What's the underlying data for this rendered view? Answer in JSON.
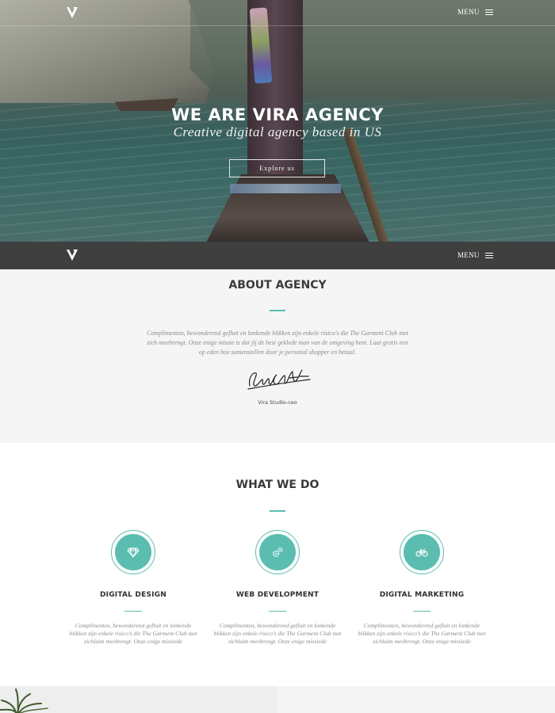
{
  "brand": {
    "logo_icon": "v-logo-icon"
  },
  "hero": {
    "menu_label": "MENU",
    "title": "WE ARE VIRA AGENCY",
    "subtitle": "Creative digital agency based in US",
    "cta_label": "Explore us"
  },
  "navbar": {
    "menu_label": "MENU"
  },
  "about": {
    "title": "ABOUT AGENCY",
    "lines": [
      "Complimenten, bewonderend gefluit en lonkende blikken zijn enkele risico's die The Garment Club met",
      "zich meebrengt. Onze enige missie is dat jij de best geklede man van de omgeving bent. Laat gratis een",
      "op eden box samenstellen door je personal shopper en betaal."
    ],
    "signature_icon": "signature-image",
    "signer": "Vira Studio-ceo"
  },
  "services": {
    "title": "WHAT WE DO",
    "items": [
      {
        "icon": "diamond-icon",
        "title": "DIGITAL DESIGN",
        "lines": [
          "Complimenten, bewonderend gefluit en lonkende",
          "blikken zijn enkele risico's die The Garment Club met",
          "zichlaim meebrengt. Onze enige missiede"
        ]
      },
      {
        "icon": "gears-icon",
        "title": "WEB DEVELOPMENT",
        "lines": [
          "Complimenten, bewonderend gefluit en lonkende",
          "blikken zijn enkele risico's die The Garment Club met",
          "zichlaim meebrengt. Onze enige missiede"
        ]
      },
      {
        "icon": "bicycle-icon",
        "title": "DIGITAL MARKETING",
        "lines": [
          "Complimenten, bewonderend gefluit en lonkende",
          "blikken zijn enkele risico's die The Garment Club met",
          "zichlaim meebrengt. Onze enige missiede"
        ]
      }
    ]
  },
  "colors": {
    "accent": "#5bbdb0",
    "navbar_bg": "#3f3f3f",
    "about_bg": "#f5f5f5"
  }
}
